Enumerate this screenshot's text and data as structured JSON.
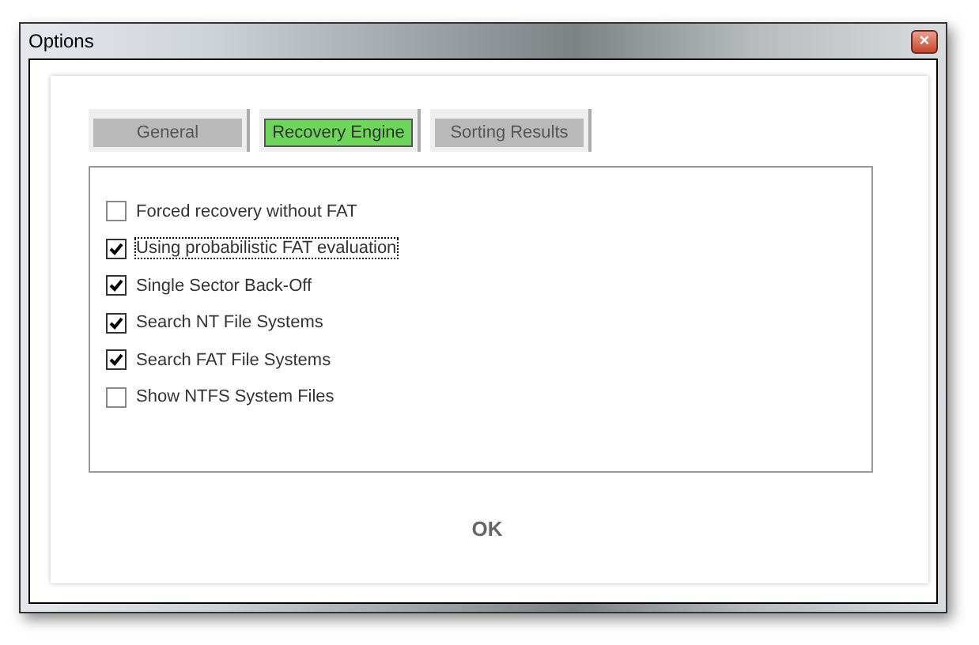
{
  "window": {
    "title": "Options",
    "close": "×"
  },
  "tabs": [
    {
      "label": "General",
      "selected": false
    },
    {
      "label": "Recovery Engine",
      "selected": true
    },
    {
      "label": "Sorting Results",
      "selected": false
    }
  ],
  "options": [
    {
      "label": "Forced recovery without FAT",
      "checked": false,
      "focused": false
    },
    {
      "label": "Using probabilistic FAT evaluation",
      "checked": true,
      "focused": true
    },
    {
      "label": "Single Sector Back-Off",
      "checked": true,
      "focused": false
    },
    {
      "label": "Search NT File Systems",
      "checked": true,
      "focused": false
    },
    {
      "label": "Search FAT File Systems",
      "checked": true,
      "focused": false
    },
    {
      "label": "Show NTFS System Files",
      "checked": false,
      "focused": false
    }
  ],
  "buttons": [
    "OK"
  ]
}
